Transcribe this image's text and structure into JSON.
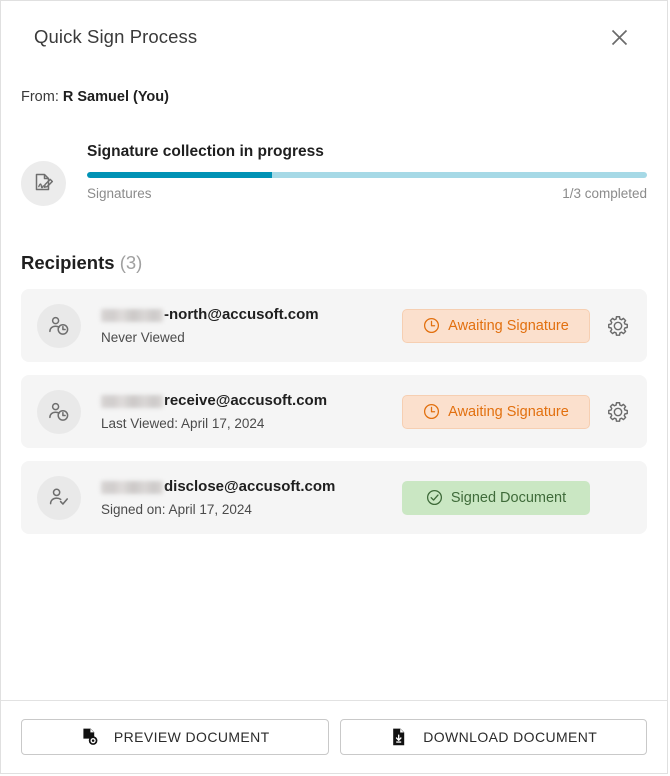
{
  "dialog": {
    "title": "Quick Sign Process",
    "close_icon": "close-icon"
  },
  "from": {
    "label": "From:",
    "value": "R Samuel (You)"
  },
  "progress": {
    "icon": "document-signature-icon",
    "title": "Signature collection in progress",
    "track_label": "Signatures",
    "completed_label": "1/3 completed",
    "percent": 33,
    "fill_color": "#0092b5",
    "track_color": "#a6d9e6"
  },
  "recipients_section": {
    "heading": "Recipients",
    "count_label": "(3)"
  },
  "recipients": [
    {
      "avatar_icon": "person-clock-icon",
      "email_redacted_width": 62,
      "email": "-north@accusoft.com",
      "sub": "Never Viewed",
      "status": "Awaiting Signature",
      "status_type": "awaiting",
      "status_icon": "clock-icon",
      "has_settings": true,
      "settings_icon": "gear-icon"
    },
    {
      "avatar_icon": "person-clock-icon",
      "email_redacted_width": 62,
      "email": "receive@accusoft.com",
      "sub": "Last Viewed: April 17, 2024",
      "status": "Awaiting Signature",
      "status_type": "awaiting",
      "status_icon": "clock-icon",
      "has_settings": true,
      "settings_icon": "gear-icon"
    },
    {
      "avatar_icon": "person-check-icon",
      "email_redacted_width": 62,
      "email": "disclose@accusoft.com",
      "sub": "Signed on: April 17, 2024",
      "status": "Signed Document",
      "status_type": "signed",
      "status_icon": "check-circle-icon",
      "has_settings": false
    }
  ],
  "footer": {
    "preview_label": "PREVIEW DOCUMENT",
    "preview_icon": "document-eye-icon",
    "download_label": "DOWNLOAD DOCUMENT",
    "download_icon": "document-download-icon"
  },
  "colors": {
    "accent_teal": "#0092b5",
    "awaiting_bg": "#fbe0cd",
    "awaiting_text": "#e2700f",
    "signed_bg": "#cae7c3",
    "signed_text": "#3f6b3a",
    "row_bg": "#f5f5f5"
  }
}
